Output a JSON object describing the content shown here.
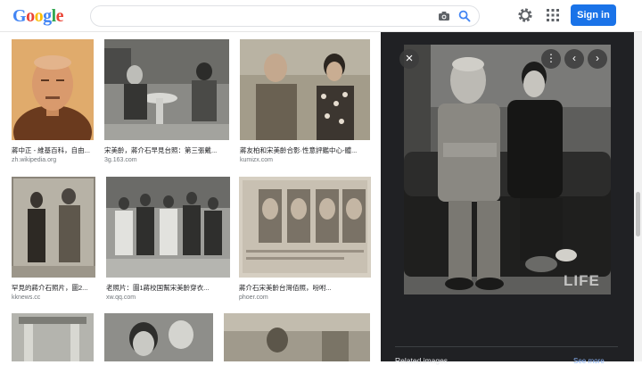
{
  "header": {
    "logo_letters": [
      "G",
      "o",
      "o",
      "g",
      "l",
      "e"
    ],
    "logo_colors": [
      "#4285f4",
      "#ea4335",
      "#fbbc05",
      "#4285f4",
      "#34a853",
      "#ea4335"
    ],
    "search_value": "",
    "signin_label": "Sign in",
    "accent": "#1a73e8"
  },
  "results": [
    {
      "caption": "蔣中正 - 維基百科，自由...",
      "source": "zh.wikipedia.org"
    },
    {
      "caption": "宋美齡，蔣介石早見台照：第三張戴...",
      "source": "3g.163.com"
    },
    {
      "caption": "蔣友柏和宋美齡合影·性意評鑑中心-體...",
      "source": "kumizx.com"
    },
    {
      "caption": "罕見的蔣介石照片，圖2...",
      "source": "kknews.cc"
    },
    {
      "caption": "老照片：圖1蔣校国幫宋美齡穿衣...",
      "source": "xw.qq.com"
    },
    {
      "caption": "蔣介石宋美齡台灣佰照，吩咐...",
      "source": "phoer.com"
    },
    {
      "caption": "",
      "source": ""
    },
    {
      "caption": "",
      "source": ""
    },
    {
      "caption": "",
      "source": ""
    }
  ],
  "panel": {
    "watermark": "LIFE",
    "related_label": "Related images",
    "see_more_label": "See more"
  }
}
